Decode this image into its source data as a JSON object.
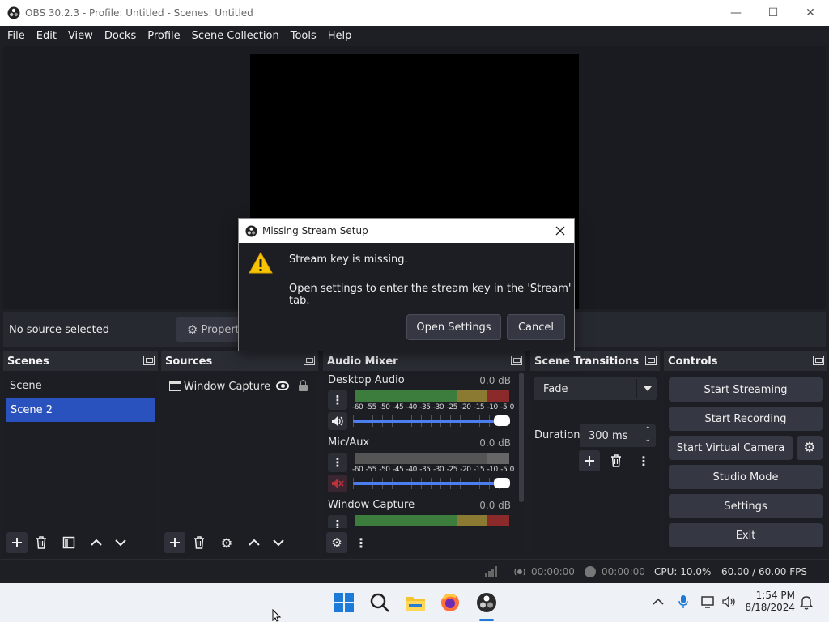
{
  "window": {
    "title": "OBS 30.2.3 - Profile: Untitled - Scenes: Untitled",
    "minimize": "—",
    "maximize": "☐",
    "close": "✕"
  },
  "menu": [
    "File",
    "Edit",
    "View",
    "Docks",
    "Profile",
    "Scene Collection",
    "Tools",
    "Help"
  ],
  "source_bar": {
    "status": "No source selected",
    "properties_label": "Properti"
  },
  "docks": {
    "scenes": {
      "title": "Scenes",
      "items": [
        "Scene",
        "Scene 2"
      ],
      "selected_index": 1
    },
    "sources": {
      "title": "Sources",
      "items": [
        "Window Capture"
      ]
    },
    "audio_mixer": {
      "title": "Audio Mixer",
      "channels": [
        {
          "name": "Desktop Audio",
          "db": "0.0 dB",
          "muted": false
        },
        {
          "name": "Mic/Aux",
          "db": "0.0 dB",
          "muted": true
        },
        {
          "name": "Window Capture",
          "db": "0.0 dB",
          "muted": false
        }
      ],
      "scale": [
        "-60",
        "-55",
        "-50",
        "-45",
        "-40",
        "-35",
        "-30",
        "-25",
        "-20",
        "-15",
        "-10",
        "-5",
        "0"
      ]
    },
    "transitions": {
      "title": "Scene Transitions",
      "selected": "Fade",
      "duration_label": "Duration",
      "duration_value": "300 ms"
    },
    "controls": {
      "title": "Controls",
      "buttons": [
        "Start Streaming",
        "Start Recording",
        "Start Virtual Camera",
        "Studio Mode",
        "Settings",
        "Exit"
      ]
    }
  },
  "status": {
    "stream_time": "00:00:00",
    "record_time": "00:00:00",
    "cpu": "CPU: 10.0%",
    "fps": "60.00 / 60.00 FPS"
  },
  "dialog": {
    "title": "Missing Stream Setup",
    "message_main": "Stream key is missing.",
    "message_detail": "Open settings to enter the stream key in the 'Stream' tab.",
    "primary_button": "Open Settings",
    "secondary_button": "Cancel"
  },
  "taskbar": {
    "time": "1:54 PM",
    "date": "8/18/2024"
  },
  "colors": {
    "accent": "#2a52be",
    "slider": "#4c7ef0",
    "window_bg": "#1e1f25"
  }
}
